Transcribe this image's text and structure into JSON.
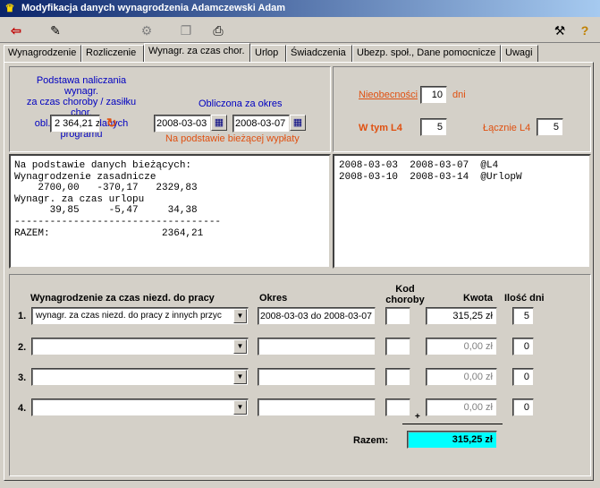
{
  "window": {
    "title": "Modyfikacja danych wynagrodzenia Adamczewski Adam"
  },
  "tabs": [
    {
      "label": "Wynagrodzenie"
    },
    {
      "label": "Rozliczenie"
    },
    {
      "label": "Wynagr. za czas chor."
    },
    {
      "label": "Urlop"
    },
    {
      "label": "Świadczenia"
    },
    {
      "label": "Ubezp. społ., Dane pomocnicze"
    },
    {
      "label": "Uwagi"
    }
  ],
  "basis": {
    "label": "Podstawa  naliczania wynagr.\nza czas choroby / zasiłku chor.\nobl. na podst. danych programu",
    "value": "2 364,21 zł",
    "period_label": "Obliczona za okres",
    "date_from": "2008-03-03",
    "date_to": "2008-03-07",
    "source_note": "Na podstawie bieżącej wypłaty"
  },
  "absence": {
    "nieobecnosci_label": "Nieobecności",
    "nieobecnosci_value": "10",
    "dni_label": "dni",
    "w_tym_l4_label": "W tym L4",
    "w_tym_l4_value": "5",
    "lacznie_l4_label": "Łącznie L4",
    "lacznie_l4_value": "5"
  },
  "calc_text": "Na podstawie danych bieżących:\nWynagrodzenie zasadnicze\n    2700,00   -370,17   2329,83\nWynagr. za czas urlopu\n      39,85     -5,47     34,38\n-----------------------------------\nRAZEM:                   2364,21",
  "periods_text": "2008-03-03  2008-03-07  @L4\n2008-03-10  2008-03-14  @UrlopW",
  "table": {
    "col_type": "Wynagrodzenie za czas niezd. do pracy",
    "col_period": "Okres",
    "col_code": "Kod\nchoroby",
    "col_amount": "Kwota",
    "col_days": "Ilość dni",
    "rows": [
      {
        "num": "1.",
        "type": "wynagr. za czas niezd. do pracy z innych przyc",
        "period": "2008-03-03 do 2008-03-07",
        "code": "",
        "amount": "315,25 zł",
        "days": "5"
      },
      {
        "num": "2.",
        "type": "",
        "period": "",
        "code": "",
        "amount": "0,00 zł",
        "days": "0"
      },
      {
        "num": "3.",
        "type": "",
        "period": "",
        "code": "",
        "amount": "0,00 zł",
        "days": "0"
      },
      {
        "num": "4.",
        "type": "",
        "period": "",
        "code": "",
        "amount": "0,00 zł",
        "days": "0"
      }
    ],
    "plus": "+",
    "total_label": "Razem:",
    "total_value": "315,25 zł"
  },
  "colors": {
    "title_bar": "#0a246a",
    "total_bg": "#00ffff",
    "accent_orange": "#e05010",
    "label_blue": "#0000c0"
  }
}
